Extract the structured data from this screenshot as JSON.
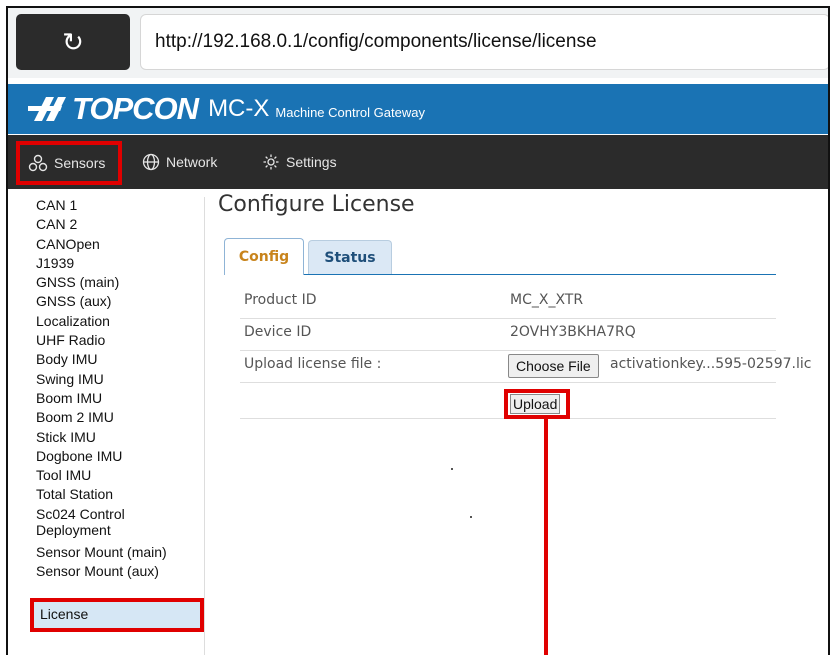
{
  "browser": {
    "reload_icon": "reload-icon",
    "url": "http://192.168.0.1/config/components/license/license"
  },
  "header": {
    "brand": "TOPCON",
    "product": "MC-X",
    "product_subtitle": "Machine Control Gateway",
    "brand_color": "#1a73b4"
  },
  "nav": {
    "items": [
      {
        "label": "Sensors",
        "icon": "sensors-icon",
        "highlighted": true
      },
      {
        "label": "Network",
        "icon": "globe-icon"
      },
      {
        "label": "Settings",
        "icon": "gear-icon"
      }
    ]
  },
  "sidebar": {
    "items": [
      "CAN 1",
      "CAN 2",
      "CANOpen",
      "J1939",
      "GNSS (main)",
      "GNSS (aux)",
      "Localization",
      "UHF Radio",
      "Body IMU",
      "Swing IMU",
      "Boom IMU",
      "Boom 2 IMU",
      "Stick IMU",
      "Dogbone IMU",
      "Tool IMU",
      "Total Station",
      "Sc024 Control Deployment",
      "Sensor Mount (main)",
      "Sensor Mount (aux)"
    ],
    "active": "License"
  },
  "main": {
    "title": "Configure License",
    "tabs": [
      {
        "label": "Config",
        "active": true
      },
      {
        "label": "Status",
        "active": false
      }
    ],
    "rows": [
      {
        "label": "Product ID",
        "value": "MC_X_XTR"
      },
      {
        "label": "Device ID",
        "value": "2OVHY3BKHA7RQ"
      }
    ],
    "upload_label": "Upload license file :",
    "choose_file_label": "Choose File",
    "file_name": "activationkey...595-02597.lic",
    "upload_button": "Upload"
  },
  "highlight_color": "#e00000"
}
